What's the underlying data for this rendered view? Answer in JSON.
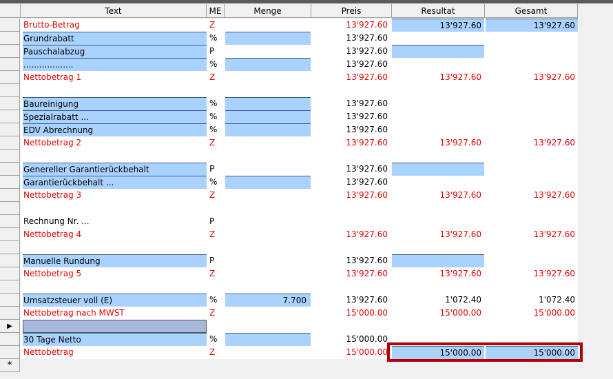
{
  "columns": {
    "text": "Text",
    "me": "ME",
    "menge": "Menge",
    "preis": "Preis",
    "resultat": "Resultat",
    "gesamt": "Gesamt"
  },
  "new_row_marker": "*",
  "current_row_marker": "▶",
  "rows": [
    {
      "text": "Brutto-Betrag",
      "me": "Z",
      "menge": "",
      "preis": "13'927.60",
      "resultat": "13'927.60",
      "gesamt": "13'927.60",
      "red": true
    },
    {
      "text": "Grundrabatt",
      "me": "%",
      "menge": "",
      "preis": "13'927.60",
      "resultat": "",
      "gesamt": ""
    },
    {
      "text": "Pauschalabzug",
      "me": "P",
      "menge": "",
      "preis": "13'927.60",
      "resultat": "",
      "gesamt": ""
    },
    {
      "text": "...................",
      "me": "%",
      "menge": "",
      "preis": "13'927.60",
      "resultat": "",
      "gesamt": ""
    },
    {
      "text": "Nettobetrag 1",
      "me": "Z",
      "menge": "",
      "preis": "13'927.60",
      "resultat": "13'927.60",
      "gesamt": "13'927.60",
      "red": true
    },
    {
      "text": "",
      "me": "",
      "menge": "",
      "preis": "",
      "resultat": "",
      "gesamt": ""
    },
    {
      "text": "Baureinigung",
      "me": "%",
      "menge": "",
      "preis": "13'927.60",
      "resultat": "",
      "gesamt": ""
    },
    {
      "text": "Spezialrabatt ...",
      "me": "%",
      "menge": "",
      "preis": "13'927.60",
      "resultat": "",
      "gesamt": ""
    },
    {
      "text": "EDV Abrechnung",
      "me": "%",
      "menge": "",
      "preis": "13'927.60",
      "resultat": "",
      "gesamt": ""
    },
    {
      "text": "Nettobetrag 2",
      "me": "Z",
      "menge": "",
      "preis": "13'927.60",
      "resultat": "13'927.60",
      "gesamt": "13'927.60",
      "red": true
    },
    {
      "text": "",
      "me": "",
      "menge": "",
      "preis": "",
      "resultat": "",
      "gesamt": ""
    },
    {
      "text": "Genereller Garantierückbehalt",
      "me": "P",
      "menge": "",
      "preis": "13'927.60",
      "resultat": "",
      "gesamt": ""
    },
    {
      "text": "Garantierückbehalt ...",
      "me": "%",
      "menge": "",
      "preis": "13'927.60",
      "resultat": "",
      "gesamt": ""
    },
    {
      "text": "Nettobetrag 3",
      "me": "Z",
      "menge": "",
      "preis": "13'927.60",
      "resultat": "13'927.60",
      "gesamt": "13'927.60",
      "red": true
    },
    {
      "text": "",
      "me": "",
      "menge": "",
      "preis": "",
      "resultat": "",
      "gesamt": ""
    },
    {
      "text": "Rechnung Nr. ...",
      "me": "P",
      "menge": "",
      "preis": "",
      "resultat": "",
      "gesamt": ""
    },
    {
      "text": "Nettobetrag 4",
      "me": "Z",
      "menge": "",
      "preis": "13'927.60",
      "resultat": "13'927.60",
      "gesamt": "13'927.60",
      "red": true
    },
    {
      "text": "",
      "me": "",
      "menge": "",
      "preis": "",
      "resultat": "",
      "gesamt": ""
    },
    {
      "text": "Manuelle Rundung",
      "me": "P",
      "menge": "",
      "preis": "13'927.60",
      "resultat": "",
      "gesamt": ""
    },
    {
      "text": "Nettobetrag 5",
      "me": "Z",
      "menge": "",
      "preis": "13'927.60",
      "resultat": "13'927.60",
      "gesamt": "13'927.60",
      "red": true
    },
    {
      "text": "",
      "me": "",
      "menge": "",
      "preis": "",
      "resultat": "",
      "gesamt": ""
    },
    {
      "text": "Umsatzsteuer voll (E)",
      "me": "%",
      "menge": "7.700",
      "preis": "13'927.60",
      "resultat": "1'072.40",
      "gesamt": "1'072.40"
    },
    {
      "text": "Nettobetrag nach MWST",
      "me": "Z",
      "menge": "",
      "preis": "15'000.00",
      "resultat": "15'000.00",
      "gesamt": "15'000.00",
      "red": true
    },
    {
      "text": "",
      "me": "",
      "menge": "",
      "preis": "",
      "resultat": "",
      "gesamt": ""
    },
    {
      "text": "30 Tage Netto",
      "me": "%",
      "menge": "",
      "preis": "15'000.00",
      "resultat": "",
      "gesamt": ""
    },
    {
      "text": "Nettobetrag",
      "me": "Z",
      "menge": "",
      "preis": "15'000.00",
      "resultat": "15'000.00",
      "gesamt": "15'000.00",
      "red": true
    }
  ]
}
